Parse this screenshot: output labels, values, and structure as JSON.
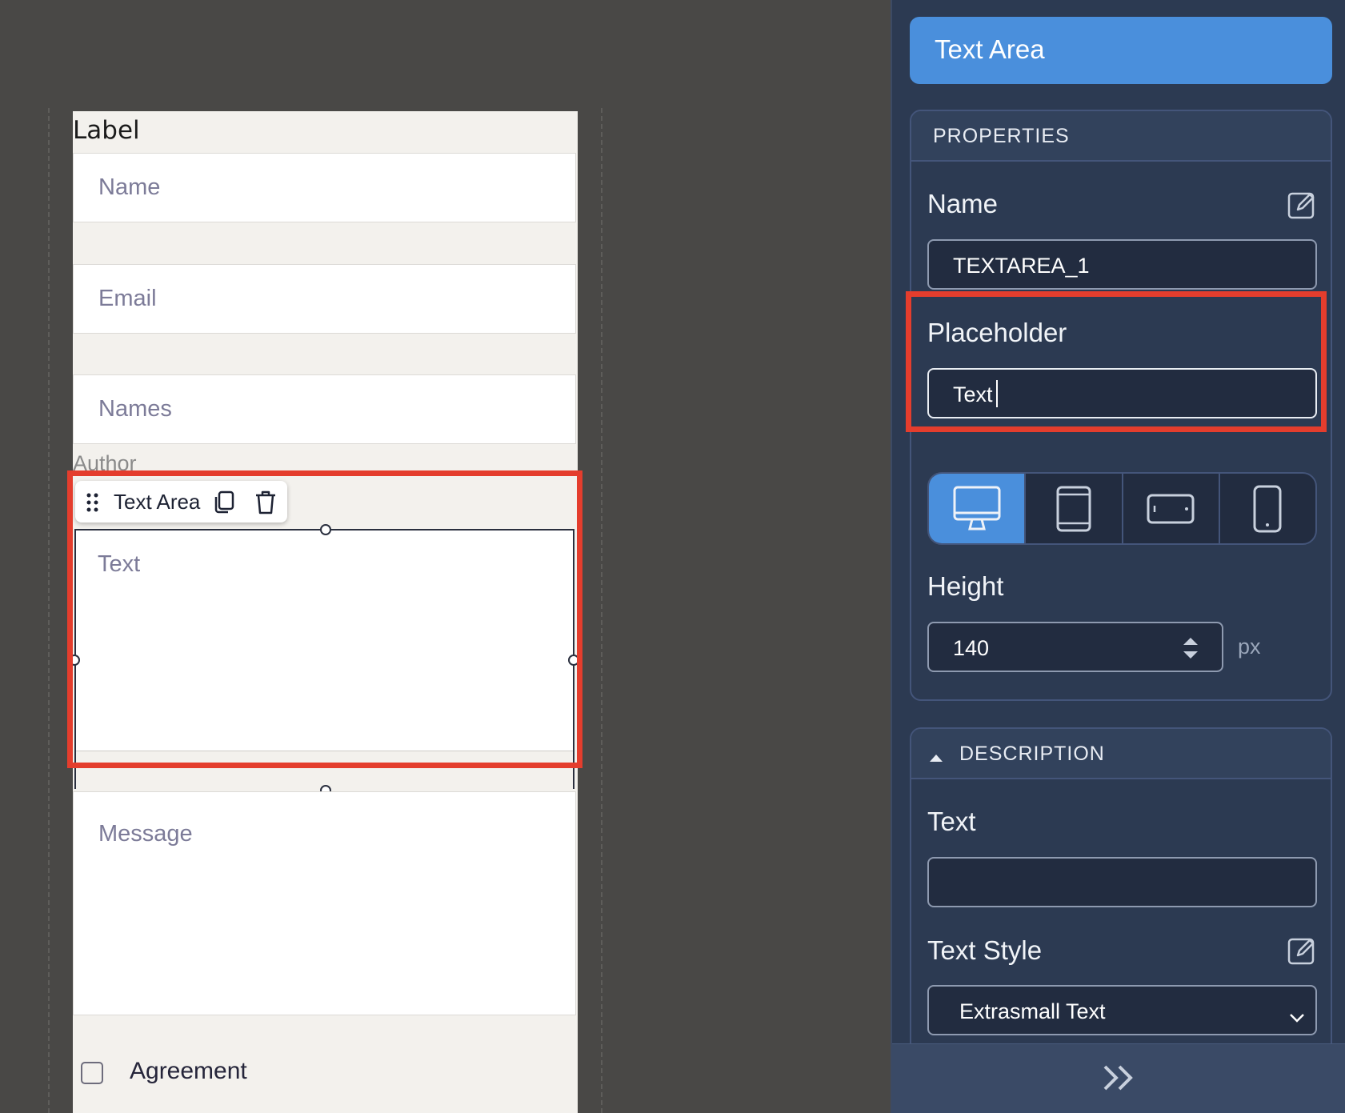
{
  "canvas": {
    "form_title_label": "Label",
    "fields": [
      {
        "placeholder": "Name"
      },
      {
        "placeholder": "Email"
      },
      {
        "placeholder": "Names"
      }
    ],
    "author_label": "Author",
    "selected_component": {
      "toolbar_label": "Text Area",
      "placeholder": "Text"
    },
    "message_placeholder": "Message",
    "agreement_label": "Agreement"
  },
  "panel": {
    "header_title": "Text Area",
    "properties": {
      "section_title": "PROPERTIES",
      "name_label": "Name",
      "name_value": "TEXTAREA_1",
      "placeholder_label": "Placeholder",
      "placeholder_value": "Text",
      "devices": [
        "desktop",
        "tablet-portrait",
        "tablet-landscape",
        "mobile"
      ],
      "active_device": "desktop",
      "height_label": "Height",
      "height_value": "140",
      "height_unit": "px"
    },
    "description": {
      "section_title": "DESCRIPTION",
      "text_label": "Text",
      "text_value": "",
      "text_style_label": "Text Style",
      "text_style_value": "Extrasmall Text"
    },
    "footer_icon": "double-chevron-right-icon"
  },
  "colors": {
    "accent": "#4a8fdc",
    "highlight": "#e43d2d",
    "panel_bg": "#2c3a52",
    "canvas_bg": "#494846"
  }
}
